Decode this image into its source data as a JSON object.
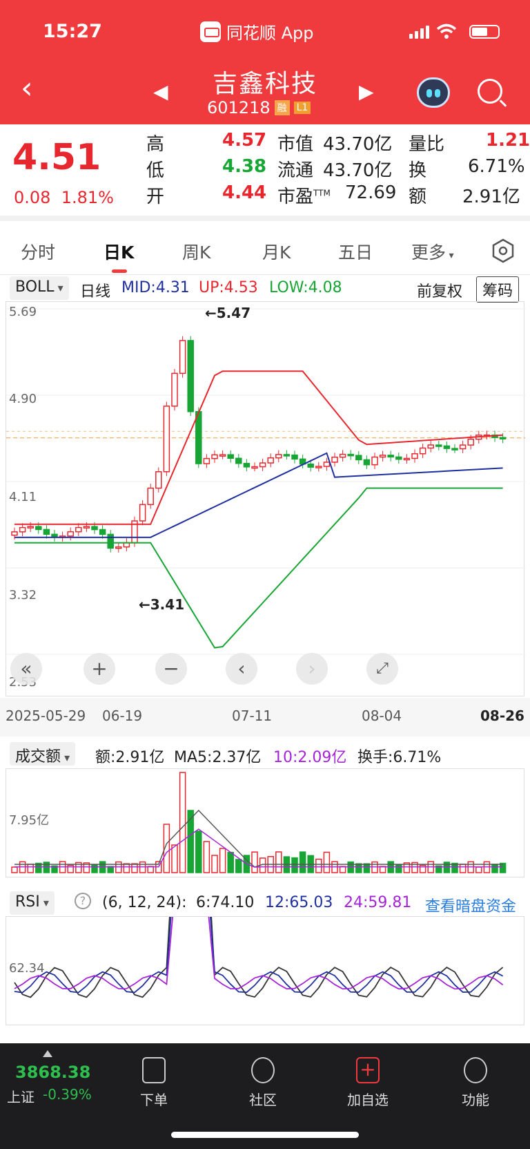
{
  "status": {
    "time": "15:27",
    "app": "同花顺 App"
  },
  "header": {
    "name": "吉鑫科技",
    "code": "601218",
    "tags": [
      "融",
      "L1"
    ]
  },
  "quote": {
    "price": "4.51",
    "change": "0.08",
    "pct": "1.81%",
    "high_label": "高",
    "high": "4.57",
    "low_label": "低",
    "low": "4.38",
    "open_label": "开",
    "open": "4.44",
    "mcap_label": "市值",
    "mcap": "43.70亿",
    "float_label": "流通",
    "float": "43.70亿",
    "pe_label": "市盈",
    "pe_sup": "TTM",
    "pe": "72.69",
    "vr_label": "量比",
    "vr": "1.21",
    "turn_label": "换",
    "turn": "6.71%",
    "amt_label": "额",
    "amt": "2.91亿"
  },
  "tabs": [
    "分时",
    "日K",
    "周K",
    "月K",
    "五日",
    "更多"
  ],
  "boll": {
    "selector": "BOLL",
    "period": "日线",
    "mid": "MID:4.31",
    "up": "UP:4.53",
    "low": "LOW:4.08",
    "adjust": "前复权",
    "chips": "筹码"
  },
  "price_axis": [
    "5.69",
    "4.90",
    "4.11",
    "3.32",
    "2.53"
  ],
  "date_axis": [
    "2025-05-29",
    "06-19",
    "07-11",
    "08-04",
    "08-26"
  ],
  "annotations": {
    "high": "←5.47",
    "low": "←3.41"
  },
  "volume": {
    "selector": "成交额",
    "amt": "额:2.91亿",
    "ma5": "MA5:2.37亿",
    "ma10": "10:2.09亿",
    "turn": "换手:6.71%",
    "axis": "7.95亿"
  },
  "rsi": {
    "selector": "RSI",
    "params": "(6, 12, 24):",
    "r6": "6:74.10",
    "r12": "12:65.03",
    "r24": "24:59.81",
    "link": "查看暗盘资金",
    "axis": "62.34"
  },
  "bottom": {
    "index_value": "3868.38",
    "index_name": "上证",
    "index_pct": "-0.39%",
    "nav": [
      "下单",
      "社区",
      "加自选",
      "功能"
    ]
  },
  "chart_data": {
    "type": "candlestick",
    "price_ylim": [
      2.53,
      5.69
    ],
    "price_ticks": [
      5.69,
      4.9,
      4.11,
      3.32,
      2.53
    ],
    "series": [
      {
        "name": "MID",
        "last": 4.31
      },
      {
        "name": "UP",
        "last": 4.53
      },
      {
        "name": "LOW",
        "last": 4.08
      }
    ],
    "max_price": 5.47,
    "min_price": 3.41,
    "volume_axis": "7.95亿",
    "rsi": {
      "RSI6": 74.1,
      "RSI12": 65.03,
      "RSI24": 59.81
    }
  },
  "colors": {
    "up": "#e8262e",
    "down": "#17a534",
    "mid": "#1f2fa0",
    "header": "#ef3b3e"
  }
}
